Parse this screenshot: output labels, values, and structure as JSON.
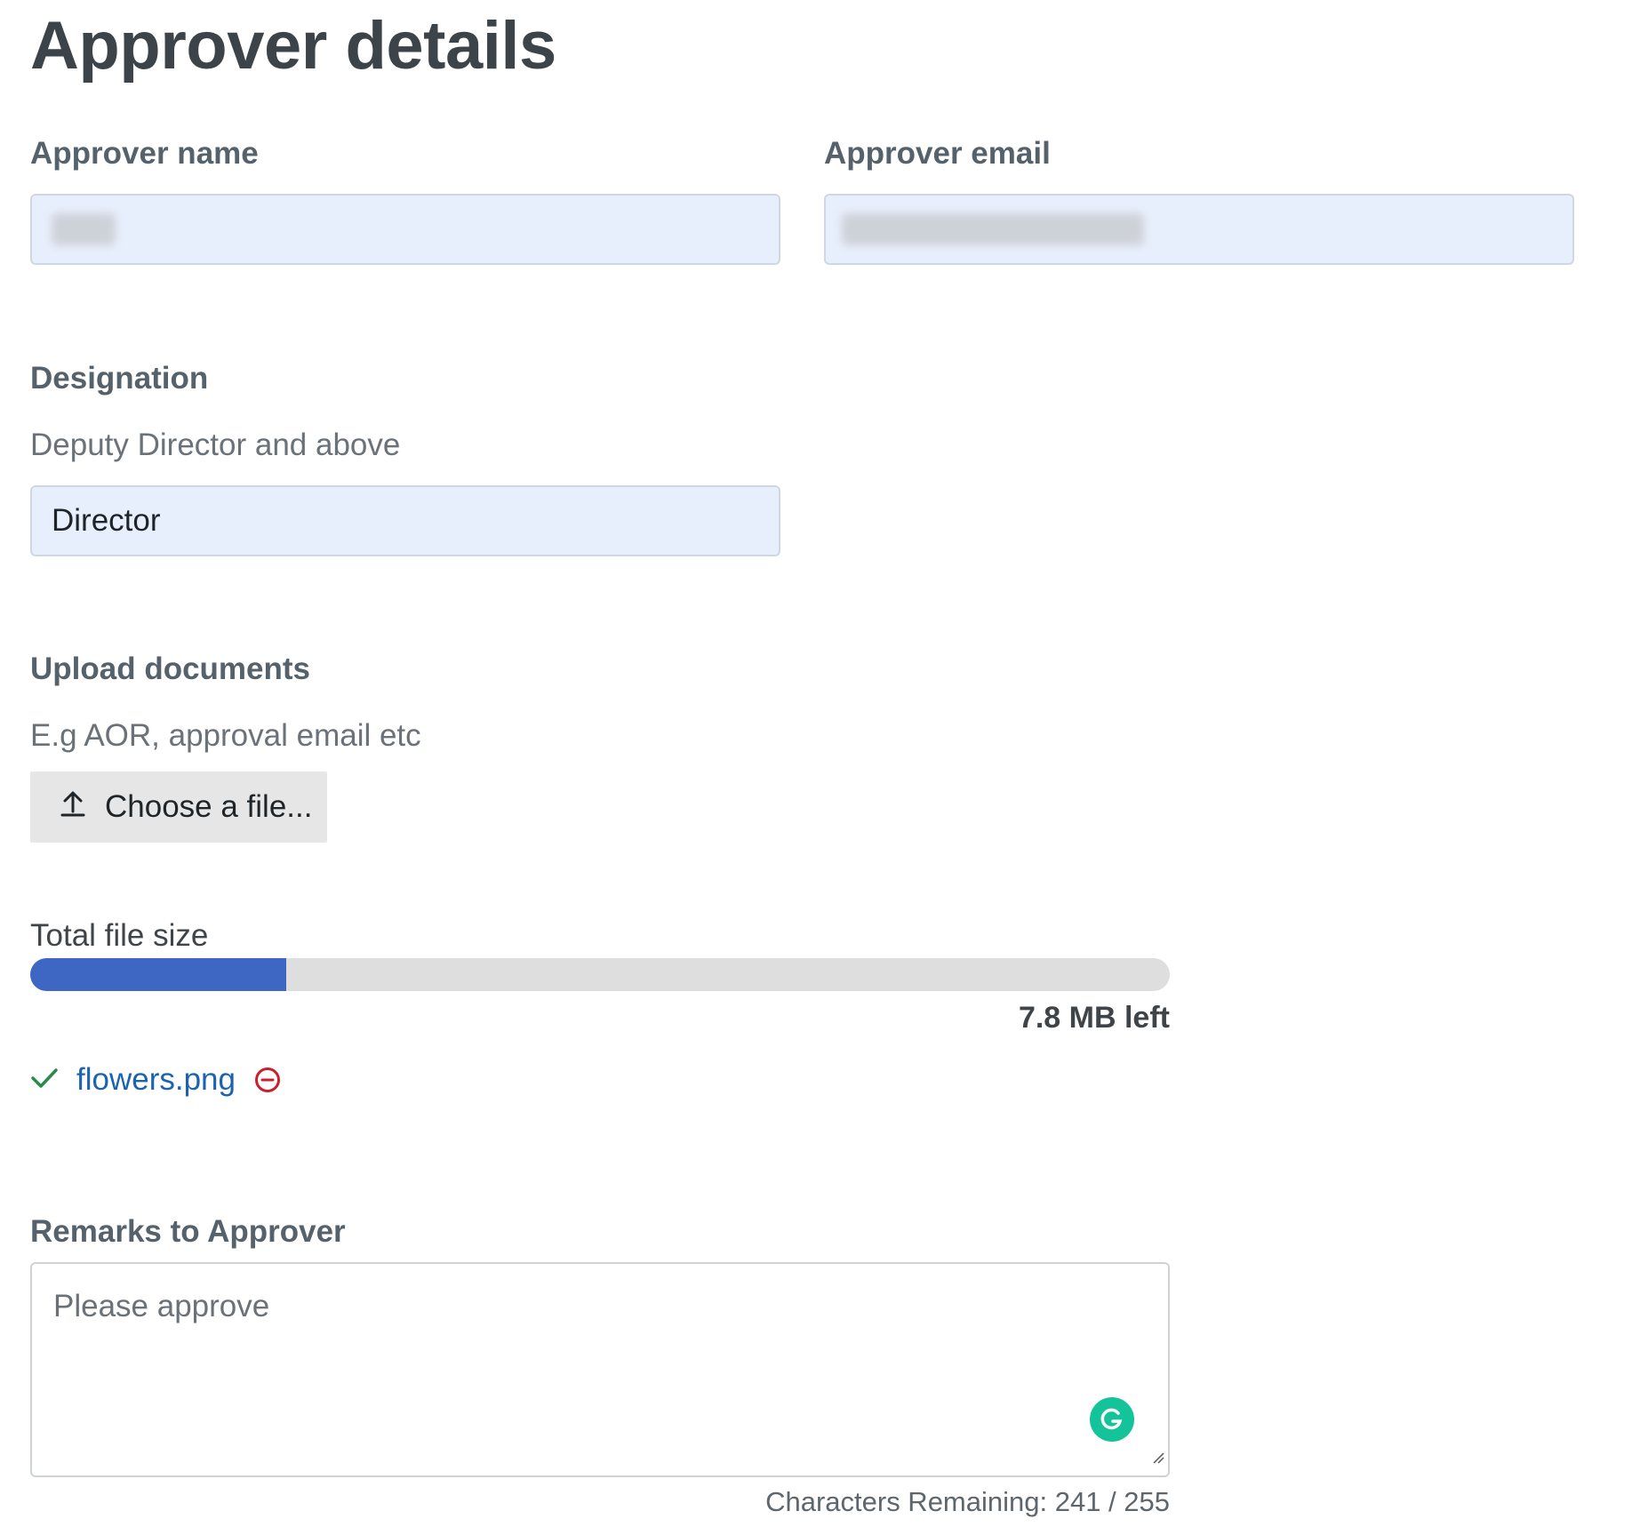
{
  "page_title": "Approver details",
  "approver_name": {
    "label": "Approver name",
    "value": ""
  },
  "approver_email": {
    "label": "Approver email",
    "value": ""
  },
  "designation": {
    "label": "Designation",
    "hint": "Deputy Director and above",
    "value": "Director"
  },
  "upload": {
    "label": "Upload documents",
    "hint": "E.g AOR, approval email etc",
    "button_label": "Choose a file..."
  },
  "file_size": {
    "label": "Total file size",
    "used_fraction": 0.225,
    "remaining_text": "7.8 MB left",
    "bar_color": "#3d67c3"
  },
  "files": [
    {
      "name": "flowers.png",
      "status_icon": "check-icon",
      "remove_icon": "remove-circle-icon"
    }
  ],
  "remarks": {
    "label": "Remarks to Approver",
    "value": "Please approve",
    "counter": "Characters Remaining: 241 / 255"
  }
}
